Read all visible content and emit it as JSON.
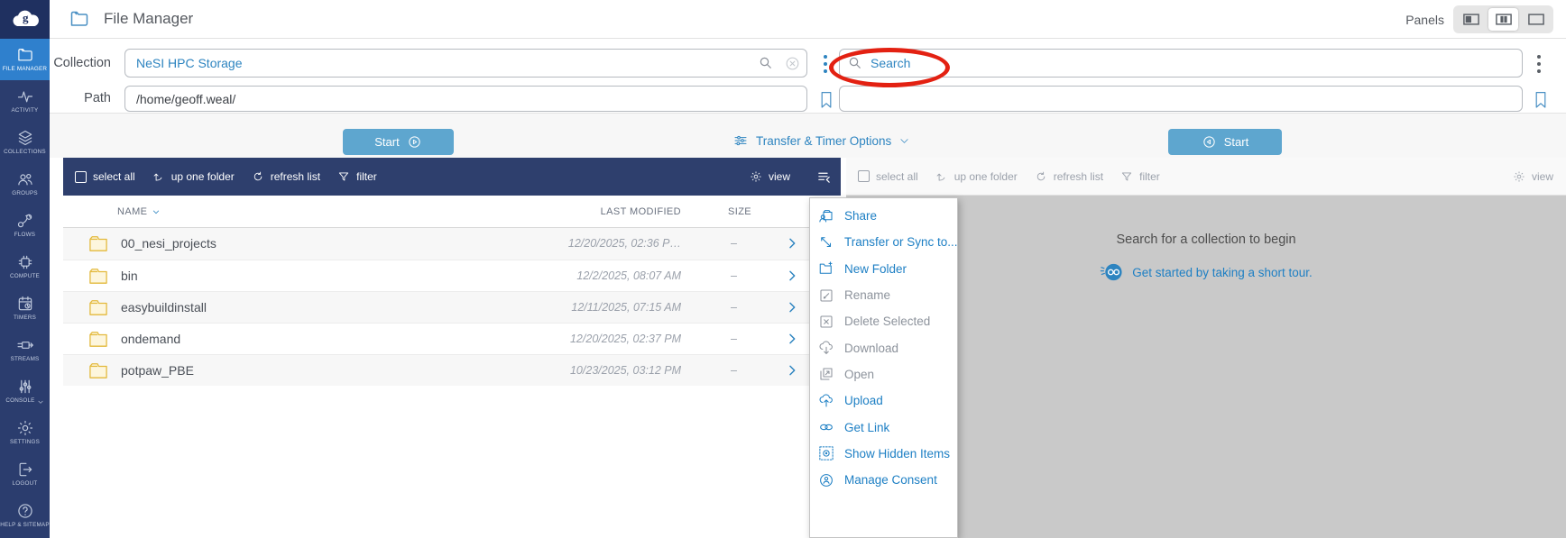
{
  "app": {
    "title": "File Manager"
  },
  "topbar": {
    "panels_label": "Panels"
  },
  "sidebar": {
    "items": [
      {
        "label": "FILE MANAGER",
        "active": true
      },
      {
        "label": "ACTIVITY"
      },
      {
        "label": "COLLECTIONS"
      },
      {
        "label": "GROUPS"
      },
      {
        "label": "FLOWS"
      },
      {
        "label": "COMPUTE"
      },
      {
        "label": "TIMERS"
      },
      {
        "label": "STREAMS"
      },
      {
        "label": "CONSOLE"
      },
      {
        "label": "SETTINGS"
      },
      {
        "label": "LOGOUT"
      },
      {
        "label": "HELP & SITEMAP"
      }
    ]
  },
  "form": {
    "collection_label": "Collection",
    "path_label": "Path",
    "collection_value": "NeSI HPC Storage",
    "path_value": "/home/geoff.weal/",
    "search_placeholder": "Search"
  },
  "transfer": {
    "start_left": "Start",
    "start_right": "Start",
    "options_label": "Transfer & Timer Options"
  },
  "toolbar": {
    "select_all": "select all",
    "up_one_folder": "up one folder",
    "refresh_list": "refresh list",
    "filter": "filter",
    "view": "view"
  },
  "table": {
    "columns": {
      "name": "NAME",
      "last_modified": "LAST MODIFIED",
      "size": "SIZE"
    },
    "rows": [
      {
        "name": "00_nesi_projects",
        "last_modified": "12/20/2025, 02:36 P…",
        "size": "–"
      },
      {
        "name": "bin",
        "last_modified": "12/2/2025, 08:07 AM",
        "size": "–"
      },
      {
        "name": "easybuildinstall",
        "last_modified": "12/11/2025, 07:15 AM",
        "size": "–"
      },
      {
        "name": "ondemand",
        "last_modified": "12/20/2025, 02:37 PM",
        "size": "–"
      },
      {
        "name": "potpaw_PBE",
        "last_modified": "10/23/2025, 03:12 PM",
        "size": "–"
      }
    ]
  },
  "menu": {
    "items": [
      {
        "label": "Share",
        "enabled": true
      },
      {
        "label": "Transfer or Sync to...",
        "enabled": true
      },
      {
        "label": "New Folder",
        "enabled": true
      },
      {
        "label": "Rename",
        "enabled": false
      },
      {
        "label": "Delete Selected",
        "enabled": false
      },
      {
        "label": "Download",
        "enabled": false
      },
      {
        "label": "Open",
        "enabled": false
      },
      {
        "label": "Upload",
        "enabled": true
      },
      {
        "label": "Get Link",
        "enabled": true
      },
      {
        "label": "Show Hidden Items",
        "enabled": true
      },
      {
        "label": "Manage Consent",
        "enabled": true
      }
    ]
  },
  "right_panel": {
    "empty_message": "Search for a collection to begin",
    "tour_link": "Get started by taking a short tour."
  },
  "colors": {
    "accent_blue": "#2d84c0",
    "navy": "#2b3d6e",
    "active_item_blue": "#2f80cd",
    "start_button_blue": "#5ea6cf",
    "panel_gray": "#c9c9c9",
    "annotation_red": "#e32112",
    "folder_yellow": "#e3b93c"
  }
}
